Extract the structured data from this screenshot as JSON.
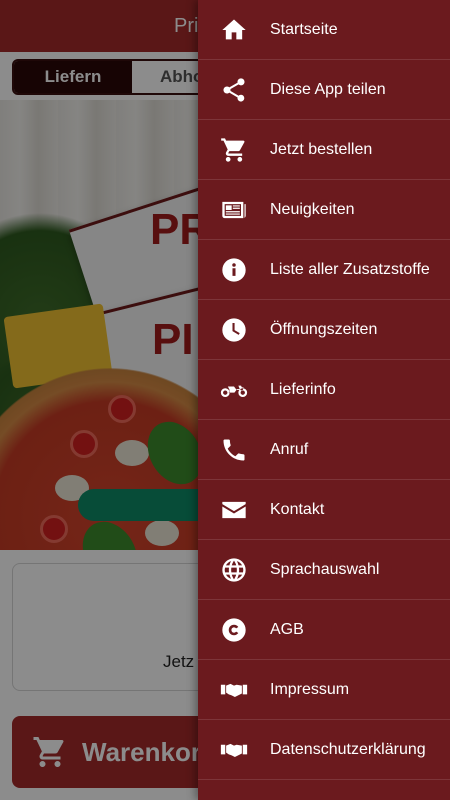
{
  "app": {
    "header_title": "Pri",
    "tabs": {
      "delivery": "Liefern",
      "pickup": "Abho"
    },
    "info_text": "Jetz",
    "cart_label": "Warenkorb"
  },
  "hero": {
    "box_text_1": "PR",
    "box_text_2": "PI"
  },
  "drawer": {
    "items": [
      {
        "label": "Startseite",
        "icon": "home-icon"
      },
      {
        "label": "Diese App teilen",
        "icon": "share-icon"
      },
      {
        "label": "Jetzt bestellen",
        "icon": "cart-icon"
      },
      {
        "label": "Neuigkeiten",
        "icon": "newspaper-icon"
      },
      {
        "label": "Liste aller Zusatzstoffe",
        "icon": "info-icon"
      },
      {
        "label": "Öffnungszeiten",
        "icon": "clock-icon"
      },
      {
        "label": "Lieferinfo",
        "icon": "motorcycle-icon"
      },
      {
        "label": "Anruf",
        "icon": "phone-icon"
      },
      {
        "label": "Kontakt",
        "icon": "envelope-icon"
      },
      {
        "label": "Sprachauswahl",
        "icon": "globe-icon"
      },
      {
        "label": "AGB",
        "icon": "copyright-icon"
      },
      {
        "label": "Impressum",
        "icon": "handshake-icon"
      },
      {
        "label": "Datenschutzerklärung",
        "icon": "handshake-icon"
      }
    ]
  },
  "colors": {
    "brand": "#a52a2a",
    "drawer_bg": "#6b1a1e",
    "cta_green": "#0d8a66"
  }
}
